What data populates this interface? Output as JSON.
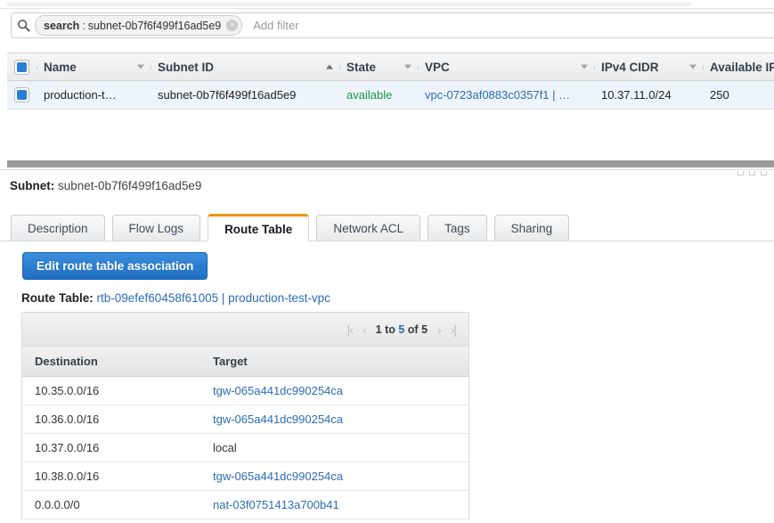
{
  "filter_bar": {
    "search_icon": "search-icon",
    "token_key": "search",
    "token_sep": ":",
    "token_value": "subnet-0b7f6f499f16ad5e9",
    "token_remove": "×",
    "add_filter_placeholder": "Add filter"
  },
  "resource_table": {
    "columns": [
      {
        "label": "Name",
        "sort": "down"
      },
      {
        "label": "Subnet ID",
        "sort": "up"
      },
      {
        "label": "State",
        "sort": "down"
      },
      {
        "label": "VPC",
        "sort": "down"
      },
      {
        "label": "IPv4 CIDR",
        "sort": "down"
      },
      {
        "label": "Available IPv",
        "sort": "none"
      }
    ],
    "rows": [
      {
        "name": "production-t…",
        "subnet_id": "subnet-0b7f6f499f16ad5e9",
        "state": "available",
        "vpc": "vpc-0723af0883c0357f1 | …",
        "ipv4_cidr": "10.37.11.0/24",
        "available_ips": "250"
      }
    ]
  },
  "detail": {
    "subnet_label": "Subnet:",
    "subnet_value": "subnet-0b7f6f499f16ad5e9",
    "tabs": [
      {
        "label": "Description",
        "active": false
      },
      {
        "label": "Flow Logs",
        "active": false
      },
      {
        "label": "Route Table",
        "active": true
      },
      {
        "label": "Network ACL",
        "active": false
      },
      {
        "label": "Tags",
        "active": false
      },
      {
        "label": "Sharing",
        "active": false
      }
    ],
    "edit_button_label": "Edit route table association",
    "route_table_label": "Route Table:",
    "route_table_value": "rtb-09efef60458f61005 | production-test-vpc"
  },
  "routes_table": {
    "pagination": {
      "first_icon": "|‹",
      "prev_icon": "‹",
      "summary_prefix": "1 to ",
      "summary_count": "5",
      "summary_mid": " of ",
      "summary_total": "5",
      "next_icon": "›",
      "last_icon": "›|"
    },
    "columns": [
      "Destination",
      "Target"
    ],
    "rows": [
      {
        "destination": "10.35.0.0/16",
        "target": "tgw-065a441dc990254ca",
        "target_is_link": true
      },
      {
        "destination": "10.36.0.0/16",
        "target": "tgw-065a441dc990254ca",
        "target_is_link": true
      },
      {
        "destination": "10.37.0.0/16",
        "target": "local",
        "target_is_link": false
      },
      {
        "destination": "10.38.0.0/16",
        "target": "tgw-065a441dc990254ca",
        "target_is_link": true
      },
      {
        "destination": "0.0.0.0/0",
        "target": "nat-03f0751413a700b41",
        "target_is_link": true
      }
    ]
  },
  "colors": {
    "accent_orange": "#ec9412",
    "link_blue": "#2b6cb8",
    "button_blue": "#2a7fd4",
    "state_green": "#1a9a3c",
    "selected_row": "#eef4fb",
    "splitter_gray": "#9a9a9a"
  }
}
